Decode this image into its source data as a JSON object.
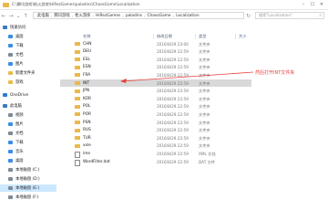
{
  "window": {
    "title": "C:\\腾讯游戏\\枪火游侠\\HiRezGames\\paladins\\ChaosGame\\Localization"
  },
  "address": {
    "segments": [
      "此电脑",
      "腾讯游戏",
      "枪火游侠",
      "HiRezGames",
      "paladins",
      "ChaosGame",
      "Localization"
    ],
    "search_placeholder": "搜索\"Localization\""
  },
  "sidebar": {
    "items": [
      {
        "label": "快速访问",
        "color": "#3a78c7",
        "selected": false
      },
      {
        "label": "桌面",
        "color": "#3a8ee6",
        "selected": false
      },
      {
        "label": "下载",
        "color": "#3a8ee6",
        "selected": false
      },
      {
        "label": "文档",
        "color": "#7d8a99",
        "selected": false
      },
      {
        "label": "图片",
        "color": "#3a8ee6",
        "selected": false
      },
      {
        "label": "新建文件夹",
        "color": "#e9b949",
        "selected": false
      },
      {
        "label": "游戏",
        "color": "#e9b949",
        "selected": false
      },
      {
        "label": "OneDrive",
        "color": "#2b7cd3",
        "selected": false
      },
      {
        "label": "此电脑",
        "color": "#3a78c7",
        "selected": false
      },
      {
        "label": "视频",
        "color": "#7d8a99",
        "selected": false
      },
      {
        "label": "图片",
        "color": "#3a8ee6",
        "selected": false
      },
      {
        "label": "文档",
        "color": "#7d8a99",
        "selected": false
      },
      {
        "label": "下载",
        "color": "#3a8ee6",
        "selected": false
      },
      {
        "label": "音乐",
        "color": "#3a8ee6",
        "selected": false
      },
      {
        "label": "桌面",
        "color": "#3a8ee6",
        "selected": false
      },
      {
        "label": "本地磁盘 (C:)",
        "color": "#7d8a99",
        "selected": false
      },
      {
        "label": "本地磁盘 (D:)",
        "color": "#7d8a99",
        "selected": false
      },
      {
        "label": "本地磁盘 (E:)",
        "color": "#7d8a99",
        "selected": true
      },
      {
        "label": "本地磁盘 (F:)",
        "color": "#7d8a99",
        "selected": false
      }
    ]
  },
  "columns": {
    "name": "名称",
    "date": "修改日期",
    "type": "类型",
    "size": "大小"
  },
  "files": [
    {
      "name": "CHN",
      "date": "2016/8/29 23:00",
      "type": "文件夹",
      "size": "",
      "kind": "folder",
      "state": ""
    },
    {
      "name": "DEU",
      "date": "2016/8/29 22:59",
      "type": "文件夹",
      "size": "",
      "kind": "folder",
      "state": ""
    },
    {
      "name": "ESL",
      "date": "2016/8/29 22:59",
      "type": "文件夹",
      "size": "",
      "kind": "folder",
      "state": ""
    },
    {
      "name": "ESN",
      "date": "2016/8/29 22:59",
      "type": "文件夹",
      "size": "",
      "kind": "folder",
      "state": ""
    },
    {
      "name": "FRA",
      "date": "2016/8/29 22:59",
      "type": "文件夹",
      "size": "",
      "kind": "folder",
      "state": ""
    },
    {
      "name": "INT",
      "date": "2016/8/29 22:59",
      "type": "文件夹",
      "size": "",
      "kind": "folder",
      "state": "hl"
    },
    {
      "name": "JPN",
      "date": "2016/8/29 22:59",
      "type": "文件夹",
      "size": "",
      "kind": "folder",
      "state": ""
    },
    {
      "name": "KOR",
      "date": "2016/8/29 22:59",
      "type": "文件夹",
      "size": "",
      "kind": "folder",
      "state": ""
    },
    {
      "name": "POL",
      "date": "2016/8/29 22:59",
      "type": "文件夹",
      "size": "",
      "kind": "folder",
      "state": ""
    },
    {
      "name": "POR",
      "date": "2016/8/29 22:59",
      "type": "文件夹",
      "size": "",
      "kind": "folder",
      "state": ""
    },
    {
      "name": "PSN",
      "date": "2016/8/29 22:59",
      "type": "文件夹",
      "size": "",
      "kind": "folder",
      "state": ""
    },
    {
      "name": "RUS",
      "date": "2016/8/29 22:59",
      "type": "文件夹",
      "size": "",
      "kind": "folder",
      "state": ""
    },
    {
      "name": "TUR",
      "date": "2016/8/29 22:59",
      "type": "文件夹",
      "size": "",
      "kind": "folder",
      "state": ""
    },
    {
      "name": "xxle",
      "date": "2016/8/29 22:59",
      "type": "文件夹",
      "size": "",
      "kind": "folder",
      "state": ""
    },
    {
      "name": "ime",
      "date": "2016/8/29 22:59",
      "type": "XML 文档",
      "size": "",
      "kind": "doc",
      "state": ""
    },
    {
      "name": "WordFilter.dat",
      "date": "2016/8/29 22:59",
      "type": "DAT 文件",
      "size": "",
      "kind": "doc",
      "state": ""
    }
  ],
  "annotation": {
    "text": "然后打开INT文件夹",
    "color": "#e8413d"
  }
}
